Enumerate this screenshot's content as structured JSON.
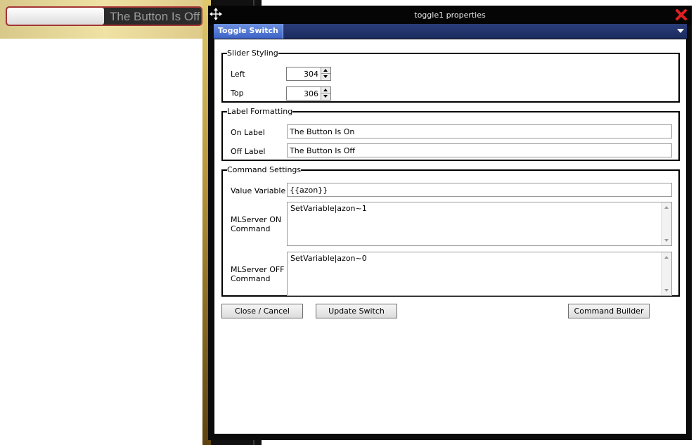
{
  "preview": {
    "toggle_label": "The Button Is Off"
  },
  "dialog": {
    "title": "toggle1 properties",
    "tab": "Toggle Switch"
  },
  "slider_styling": {
    "legend": "Slider Styling",
    "left_label": "Left",
    "left_value": "304",
    "top_label": "Top",
    "top_value": "306"
  },
  "label_formatting": {
    "legend": "Label Formatting",
    "on_label_label": "On Label",
    "on_label_value": "The Button Is On",
    "off_label_label": "Off Label",
    "off_label_value": "The Button Is Off"
  },
  "command_settings": {
    "legend": "Command Settings",
    "value_variable_label": "Value Variable",
    "value_variable_value": "{{azon}}",
    "on_command_label_1": "MLServer ON",
    "on_command_label_2": "Command",
    "on_command_value": "SetVariable|azon~1",
    "off_command_label_1": "MLServer OFF",
    "off_command_label_2": "Command",
    "off_command_value": "SetVariable|azon~0"
  },
  "buttons": {
    "close_cancel": "Close / Cancel",
    "update_switch": "Update Switch",
    "command_builder": "Command Builder"
  },
  "colors": {
    "tab_active": "#3d63c6",
    "tabbar": "#1b2b5e",
    "close_icon": "#e02020",
    "toggle_border": "#a43535"
  }
}
